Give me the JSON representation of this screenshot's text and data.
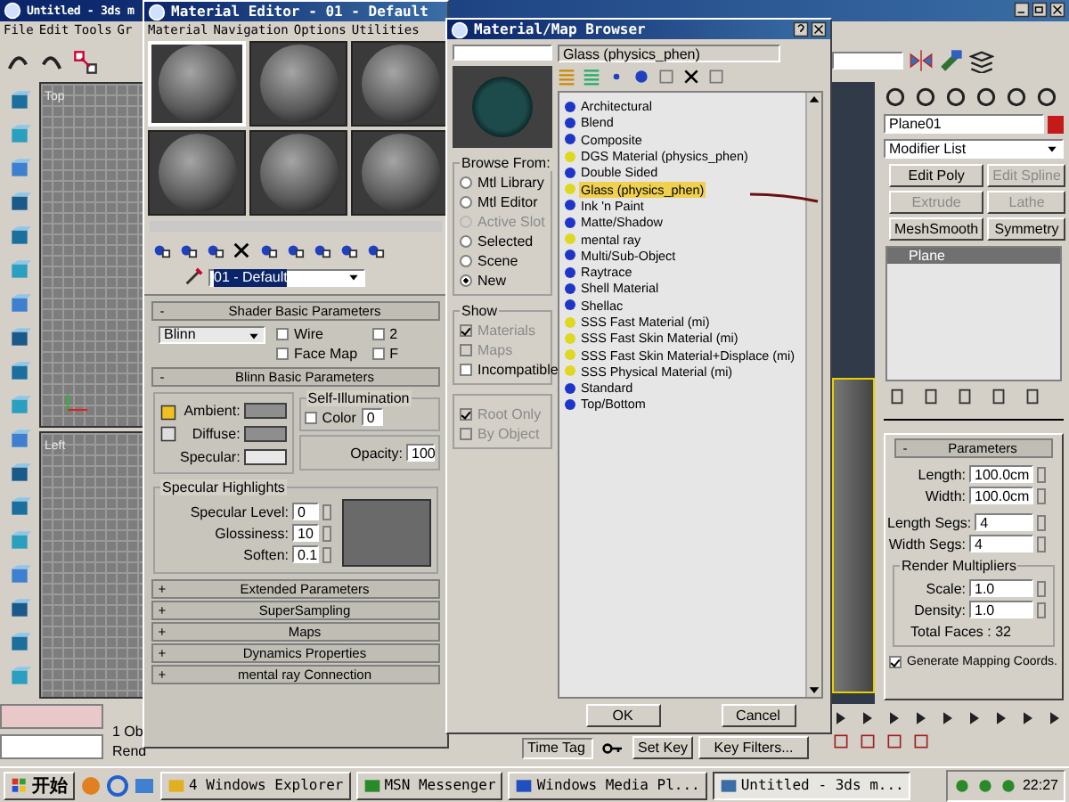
{
  "main_window": {
    "title": "Untitled - 3ds m",
    "menu": [
      "File",
      "Edit",
      "Tools",
      "Gr"
    ],
    "viewports": [
      {
        "label": "Top"
      },
      {
        "label": "Left"
      }
    ],
    "status": [
      "1 Ob",
      "Rend"
    ]
  },
  "material_editor": {
    "title": "Material Editor - 01 - Default",
    "menu": [
      "Material",
      "Navigation",
      "Options",
      "Utilities"
    ],
    "slots": [
      {
        "selected": true
      },
      {
        "selected": false
      },
      {
        "selected": false
      },
      {
        "selected": false
      },
      {
        "selected": false
      },
      {
        "selected": false
      }
    ],
    "material_name": "01 - Default",
    "shader": {
      "sign": "-",
      "title": "Shader Basic Parameters",
      "type": "Blinn",
      "options": [
        {
          "label": "Wire",
          "checked": false
        },
        {
          "label": "2",
          "checked": false
        },
        {
          "label": "Face Map",
          "checked": false
        },
        {
          "label": "F",
          "checked": false
        }
      ]
    },
    "blinn": {
      "sign": "-",
      "title": "Blinn Basic Parameters",
      "colors": [
        {
          "label": "Ambient:",
          "color": "#8e8e8e"
        },
        {
          "label": "Diffuse:",
          "color": "#8e8e8e"
        },
        {
          "label": "Specular:",
          "color": "#e8e8e8"
        }
      ],
      "self_illum": {
        "title": "Self-Illumination",
        "label": "Color",
        "checked": false,
        "value": "0"
      },
      "opacity": {
        "label": "Opacity:",
        "value": "100"
      },
      "highlights": {
        "title": "Specular Highlights",
        "fields": [
          {
            "label": "Specular Level:",
            "value": "0"
          },
          {
            "label": "Glossiness:",
            "value": "10"
          },
          {
            "label": "Soften:",
            "value": "0.1"
          }
        ]
      }
    },
    "rollouts": [
      {
        "sign": "+",
        "title": "Extended Parameters"
      },
      {
        "sign": "+",
        "title": "SuperSampling"
      },
      {
        "sign": "+",
        "title": "Maps"
      },
      {
        "sign": "+",
        "title": "Dynamics Properties"
      },
      {
        "sign": "+",
        "title": "mental ray Connection"
      }
    ]
  },
  "browser": {
    "title": "Material/Map Browser",
    "name_field": "Glass (physics_phen)",
    "browse_from": {
      "title": "Browse From:",
      "options": [
        {
          "label": "Mtl Library",
          "selected": false,
          "disabled": false
        },
        {
          "label": "Mtl Editor",
          "selected": false,
          "disabled": false
        },
        {
          "label": "Active Slot",
          "selected": false,
          "disabled": true
        },
        {
          "label": "Selected",
          "selected": false,
          "disabled": false
        },
        {
          "label": "Scene",
          "selected": false,
          "disabled": false
        },
        {
          "label": "New",
          "selected": true,
          "disabled": false
        }
      ]
    },
    "show": {
      "title": "Show",
      "options": [
        {
          "label": "Materials",
          "checked": true,
          "disabled": true
        },
        {
          "label": "Maps",
          "checked": false,
          "disabled": true
        },
        {
          "label": "Incompatible",
          "checked": false,
          "disabled": false
        }
      ],
      "filters": [
        {
          "label": "Root Only",
          "checked": true,
          "disabled": true
        },
        {
          "label": "By Object",
          "checked": false,
          "disabled": true
        }
      ]
    },
    "items": [
      {
        "label": "Architectural",
        "color": "#1f35c8",
        "selected": false
      },
      {
        "label": "Blend",
        "color": "#1f35c8",
        "selected": false
      },
      {
        "label": "Composite",
        "color": "#1f35c8",
        "selected": false
      },
      {
        "label": "DGS Material (physics_phen)",
        "color": "#e0d820",
        "selected": false
      },
      {
        "label": "Double Sided",
        "color": "#1f35c8",
        "selected": false
      },
      {
        "label": "Glass (physics_phen)",
        "color": "#e0d820",
        "selected": true
      },
      {
        "label": "Ink 'n Paint",
        "color": "#1f35c8",
        "selected": false
      },
      {
        "label": "Matte/Shadow",
        "color": "#1f35c8",
        "selected": false
      },
      {
        "label": "mental ray",
        "color": "#e0d820",
        "selected": false
      },
      {
        "label": "Multi/Sub-Object",
        "color": "#1f35c8",
        "selected": false
      },
      {
        "label": "Raytrace",
        "color": "#1f35c8",
        "selected": false
      },
      {
        "label": "Shell Material",
        "color": "#1f35c8",
        "selected": false
      },
      {
        "label": "Shellac",
        "color": "#1f35c8",
        "selected": false
      },
      {
        "label": "SSS Fast Material (mi)",
        "color": "#e0d820",
        "selected": false
      },
      {
        "label": "SSS Fast Skin Material (mi)",
        "color": "#e0d820",
        "selected": false
      },
      {
        "label": "SSS Fast Skin Material+Displace (mi)",
        "color": "#e0d820",
        "selected": false
      },
      {
        "label": "SSS Physical Material (mi)",
        "color": "#e0d820",
        "selected": false
      },
      {
        "label": "Standard",
        "color": "#1f35c8",
        "selected": false
      },
      {
        "label": "Top/Bottom",
        "color": "#1f35c8",
        "selected": false
      }
    ],
    "buttons": [
      "OK",
      "Cancel"
    ]
  },
  "command_panel": {
    "object": {
      "name": "Plane01",
      "color": "#c41a1a"
    },
    "modifier_list": "Modifier List",
    "modifier_buttons": [
      {
        "label": "Edit Poly",
        "disabled": false
      },
      {
        "label": "Edit Spline",
        "disabled": true
      },
      {
        "label": "Extrude",
        "disabled": true
      },
      {
        "label": "Lathe",
        "disabled": true
      },
      {
        "label": "MeshSmooth",
        "disabled": false
      },
      {
        "label": "Symmetry",
        "disabled": false
      }
    ],
    "stack": [
      {
        "label": "Plane",
        "selected": true
      }
    ],
    "parameters": {
      "sign": "-",
      "title": "Parameters",
      "size": [
        {
          "label": "Length:",
          "value": "100.0cm"
        },
        {
          "label": "Width:",
          "value": "100.0cm"
        }
      ],
      "segs": [
        {
          "label": "Length Segs:",
          "value": "4"
        },
        {
          "label": "Width Segs:",
          "value": "4"
        }
      ],
      "render_multipliers": {
        "title": "Render Multipliers",
        "fields": [
          {
            "label": "Scale:",
            "value": "1.0"
          },
          {
            "label": "Density:",
            "value": "1.0"
          }
        ]
      },
      "total": "Total Faces : 32",
      "mapping": {
        "label": "Generate Mapping Coords.",
        "checked": true
      }
    }
  },
  "key_bar": {
    "time_tag": "Time Tag",
    "set_key": "Set Key",
    "key_filters": "Key Filters..."
  },
  "taskbar": {
    "start": "开始",
    "tasks": [
      {
        "label": "4 Windows Explorer",
        "selected": false
      },
      {
        "label": "MSN Messenger",
        "selected": false
      },
      {
        "label": "Windows Media Pl...",
        "selected": false
      },
      {
        "label": "Untitled - 3ds m...",
        "selected": true
      }
    ],
    "clock": "22:27"
  }
}
